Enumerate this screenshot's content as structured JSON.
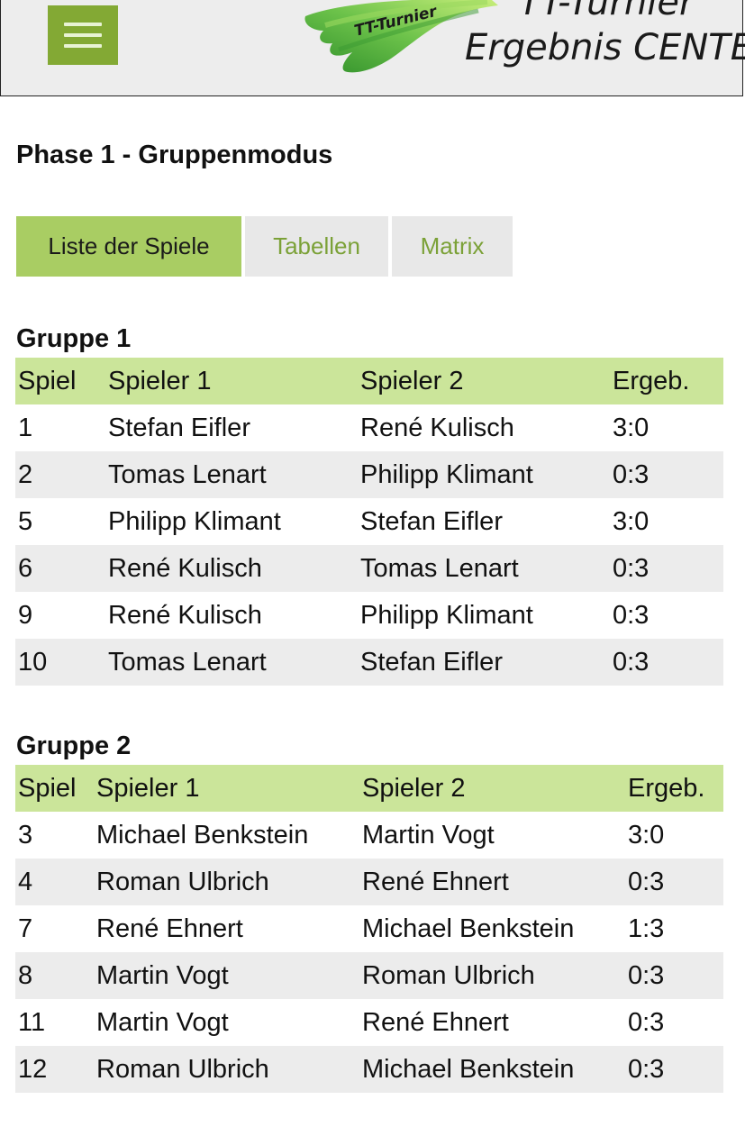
{
  "header": {
    "menu_label": "Menü",
    "logo_brush_text": "TT-Turnier",
    "logo_title_line1": "TT-Turnier",
    "logo_title_line2": "Ergebnis CENTER"
  },
  "page_title": "Phase 1 - Gruppenmodus",
  "tabs": [
    {
      "label": "Liste der Spiele",
      "active": true
    },
    {
      "label": "Tabellen",
      "active": false
    },
    {
      "label": "Matrix",
      "active": false
    }
  ],
  "groups": [
    {
      "title": "Gruppe 1",
      "columns": [
        "Spiel",
        "Spieler 1",
        "Spieler 2",
        "Ergeb."
      ],
      "rows": [
        [
          "1",
          "Stefan Eifler",
          "René Kulisch",
          "3:0"
        ],
        [
          "2",
          "Tomas Lenart",
          "Philipp Klimant",
          "0:3"
        ],
        [
          "5",
          "Philipp Klimant",
          "Stefan Eifler",
          "3:0"
        ],
        [
          "6",
          "René Kulisch",
          "Tomas Lenart",
          "0:3"
        ],
        [
          "9",
          "René Kulisch",
          "Philipp Klimant",
          "0:3"
        ],
        [
          "10",
          "Tomas Lenart",
          "Stefan Eifler",
          "0:3"
        ]
      ]
    },
    {
      "title": "Gruppe 2",
      "columns": [
        "Spiel",
        "Spieler 1",
        "Spieler 2",
        "Ergeb."
      ],
      "rows": [
        [
          "3",
          "Michael Benkstein",
          "Martin Vogt",
          "3:0"
        ],
        [
          "4",
          "Roman Ulbrich",
          "René Ehnert",
          "0:3"
        ],
        [
          "7",
          "René Ehnert",
          "Michael Benkstein",
          "1:3"
        ],
        [
          "8",
          "Martin Vogt",
          "Roman Ulbrich",
          "0:3"
        ],
        [
          "11",
          "Martin Vogt",
          "René Ehnert",
          "0:3"
        ],
        [
          "12",
          "Roman Ulbrich",
          "Michael Benkstein",
          "0:3"
        ]
      ]
    }
  ],
  "colors": {
    "accent_green": "#83a934",
    "tab_active": "#a9cd63",
    "table_header": "#cbe59a",
    "row_alt": "#ececec",
    "tab_text": "#7ba137"
  }
}
